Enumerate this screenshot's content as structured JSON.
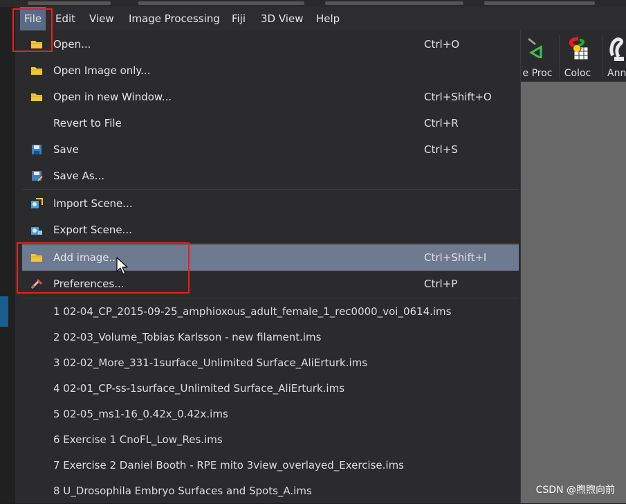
{
  "menubar": {
    "items": [
      {
        "label": "File"
      },
      {
        "label": "Edit"
      },
      {
        "label": "View"
      },
      {
        "label": "Image Processing"
      },
      {
        "label": "Fiji"
      },
      {
        "label": "3D View"
      },
      {
        "label": "Help"
      }
    ]
  },
  "toolbar": {
    "buttons": [
      {
        "label": "e Proc",
        "icon": "image-processing-icon"
      },
      {
        "label": "Coloc",
        "icon": "coloc-icon"
      },
      {
        "label": "Ann",
        "icon": "annotation-icon"
      }
    ]
  },
  "file_menu": {
    "items": [
      {
        "label": "Open...",
        "shortcut": "Ctrl+O",
        "icon": "folder-icon"
      },
      {
        "label": "Open Image only...",
        "shortcut": "",
        "icon": "folder-icon"
      },
      {
        "label": "Open in new Window...",
        "shortcut": "Ctrl+Shift+O",
        "icon": "folder-icon"
      },
      {
        "label": "Revert to File",
        "shortcut": "Ctrl+R",
        "icon": ""
      },
      {
        "label": "Save",
        "shortcut": "Ctrl+S",
        "icon": "save-icon"
      },
      {
        "label": "Save As...",
        "shortcut": "",
        "icon": "save-as-icon"
      },
      {
        "label": "Import Scene...",
        "shortcut": "",
        "icon": "import-scene-icon"
      },
      {
        "label": "Export Scene...",
        "shortcut": "",
        "icon": "export-scene-icon"
      },
      {
        "label": "Add image...",
        "shortcut": "Ctrl+Shift+I",
        "icon": "folder-icon"
      },
      {
        "label": "Preferences...",
        "shortcut": "Ctrl+P",
        "icon": "preferences-icon"
      }
    ],
    "recent_files": [
      "1 02-04_CP_2015-09-25_amphioxous_adult_female_1_rec0000_voi_0614.ims",
      "2 02-03_Volume_Tobias Karlsson - new filament.ims",
      "3 02-02_More_331-1surface_Unlimited Surface_AliErturk.ims",
      "4 02-01_CP-ss-1surface_Unlimited Surface_AliErturk.ims",
      "5 02-05_ms1-16_0.42x_0.42x.ims",
      "6 Exercise 1 CnoFL_Low_Res.ims",
      "7 Exercise 2 Daniel Booth - RPE mito 3view_overlayed_Exercise.ims",
      "8 U_Drosophila Embryo Surfaces and Spots_A.ims"
    ]
  },
  "watermark": "CSDN @煦煦向前",
  "colors": {
    "highlight": "#6e7a90",
    "menu_bg": "#2b2b2d",
    "annotation_red": "#e8211e"
  }
}
